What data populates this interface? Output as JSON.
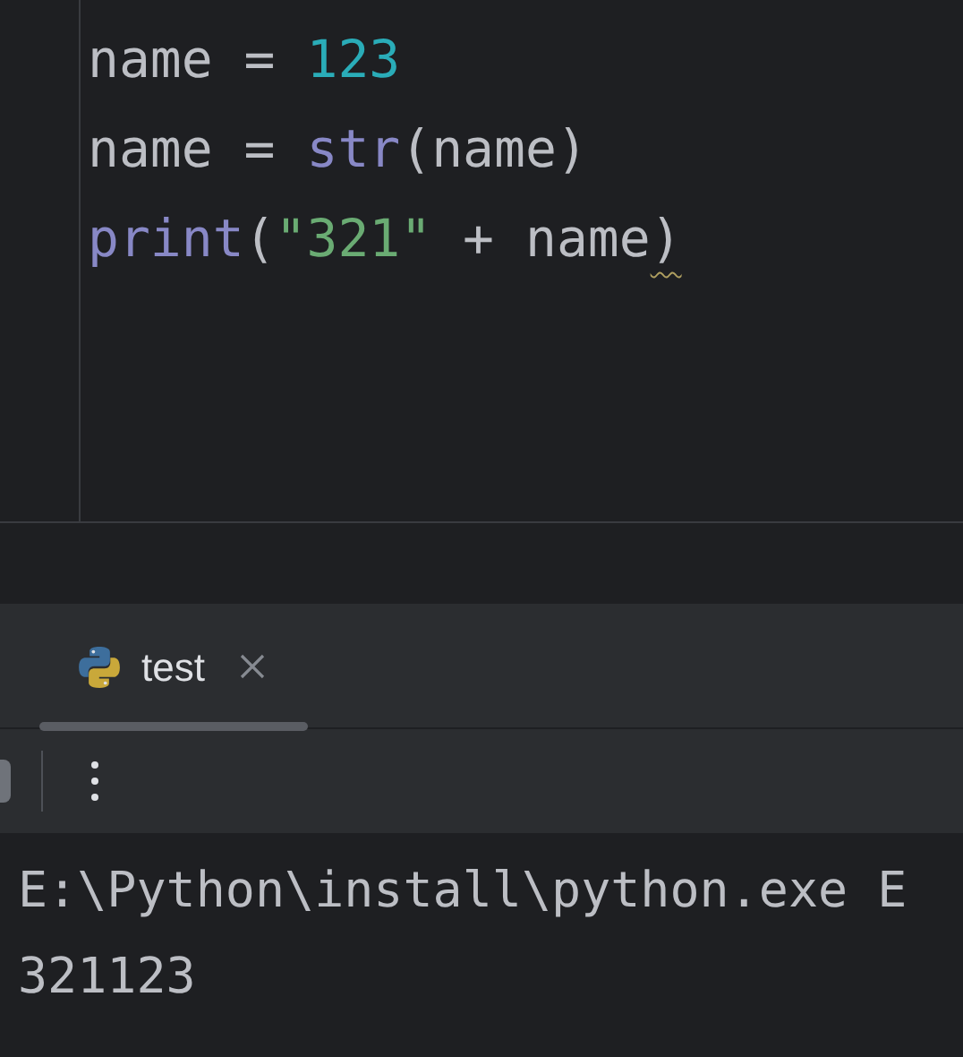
{
  "editor": {
    "lines": [
      [
        {
          "kind": "identifier",
          "text": "name"
        },
        {
          "kind": "operator",
          "text": " = "
        },
        {
          "kind": "number",
          "text": "123"
        }
      ],
      [
        {
          "kind": "identifier",
          "text": "name"
        },
        {
          "kind": "operator",
          "text": " = "
        },
        {
          "kind": "builtin",
          "text": "str"
        },
        {
          "kind": "identifier",
          "text": "(name)"
        }
      ],
      [
        {
          "kind": "builtin",
          "text": "print"
        },
        {
          "kind": "identifier",
          "text": "("
        },
        {
          "kind": "string",
          "text": "\"321\""
        },
        {
          "kind": "operator",
          "text": " + "
        },
        {
          "kind": "identifier",
          "text": "name"
        },
        {
          "kind": "identifier",
          "text": ")",
          "warning": true
        }
      ]
    ]
  },
  "run_panel": {
    "tabs": [
      {
        "label": "test",
        "selected": true
      }
    ],
    "console": [
      "E:\\Python\\install\\python.exe E",
      "321123"
    ]
  }
}
